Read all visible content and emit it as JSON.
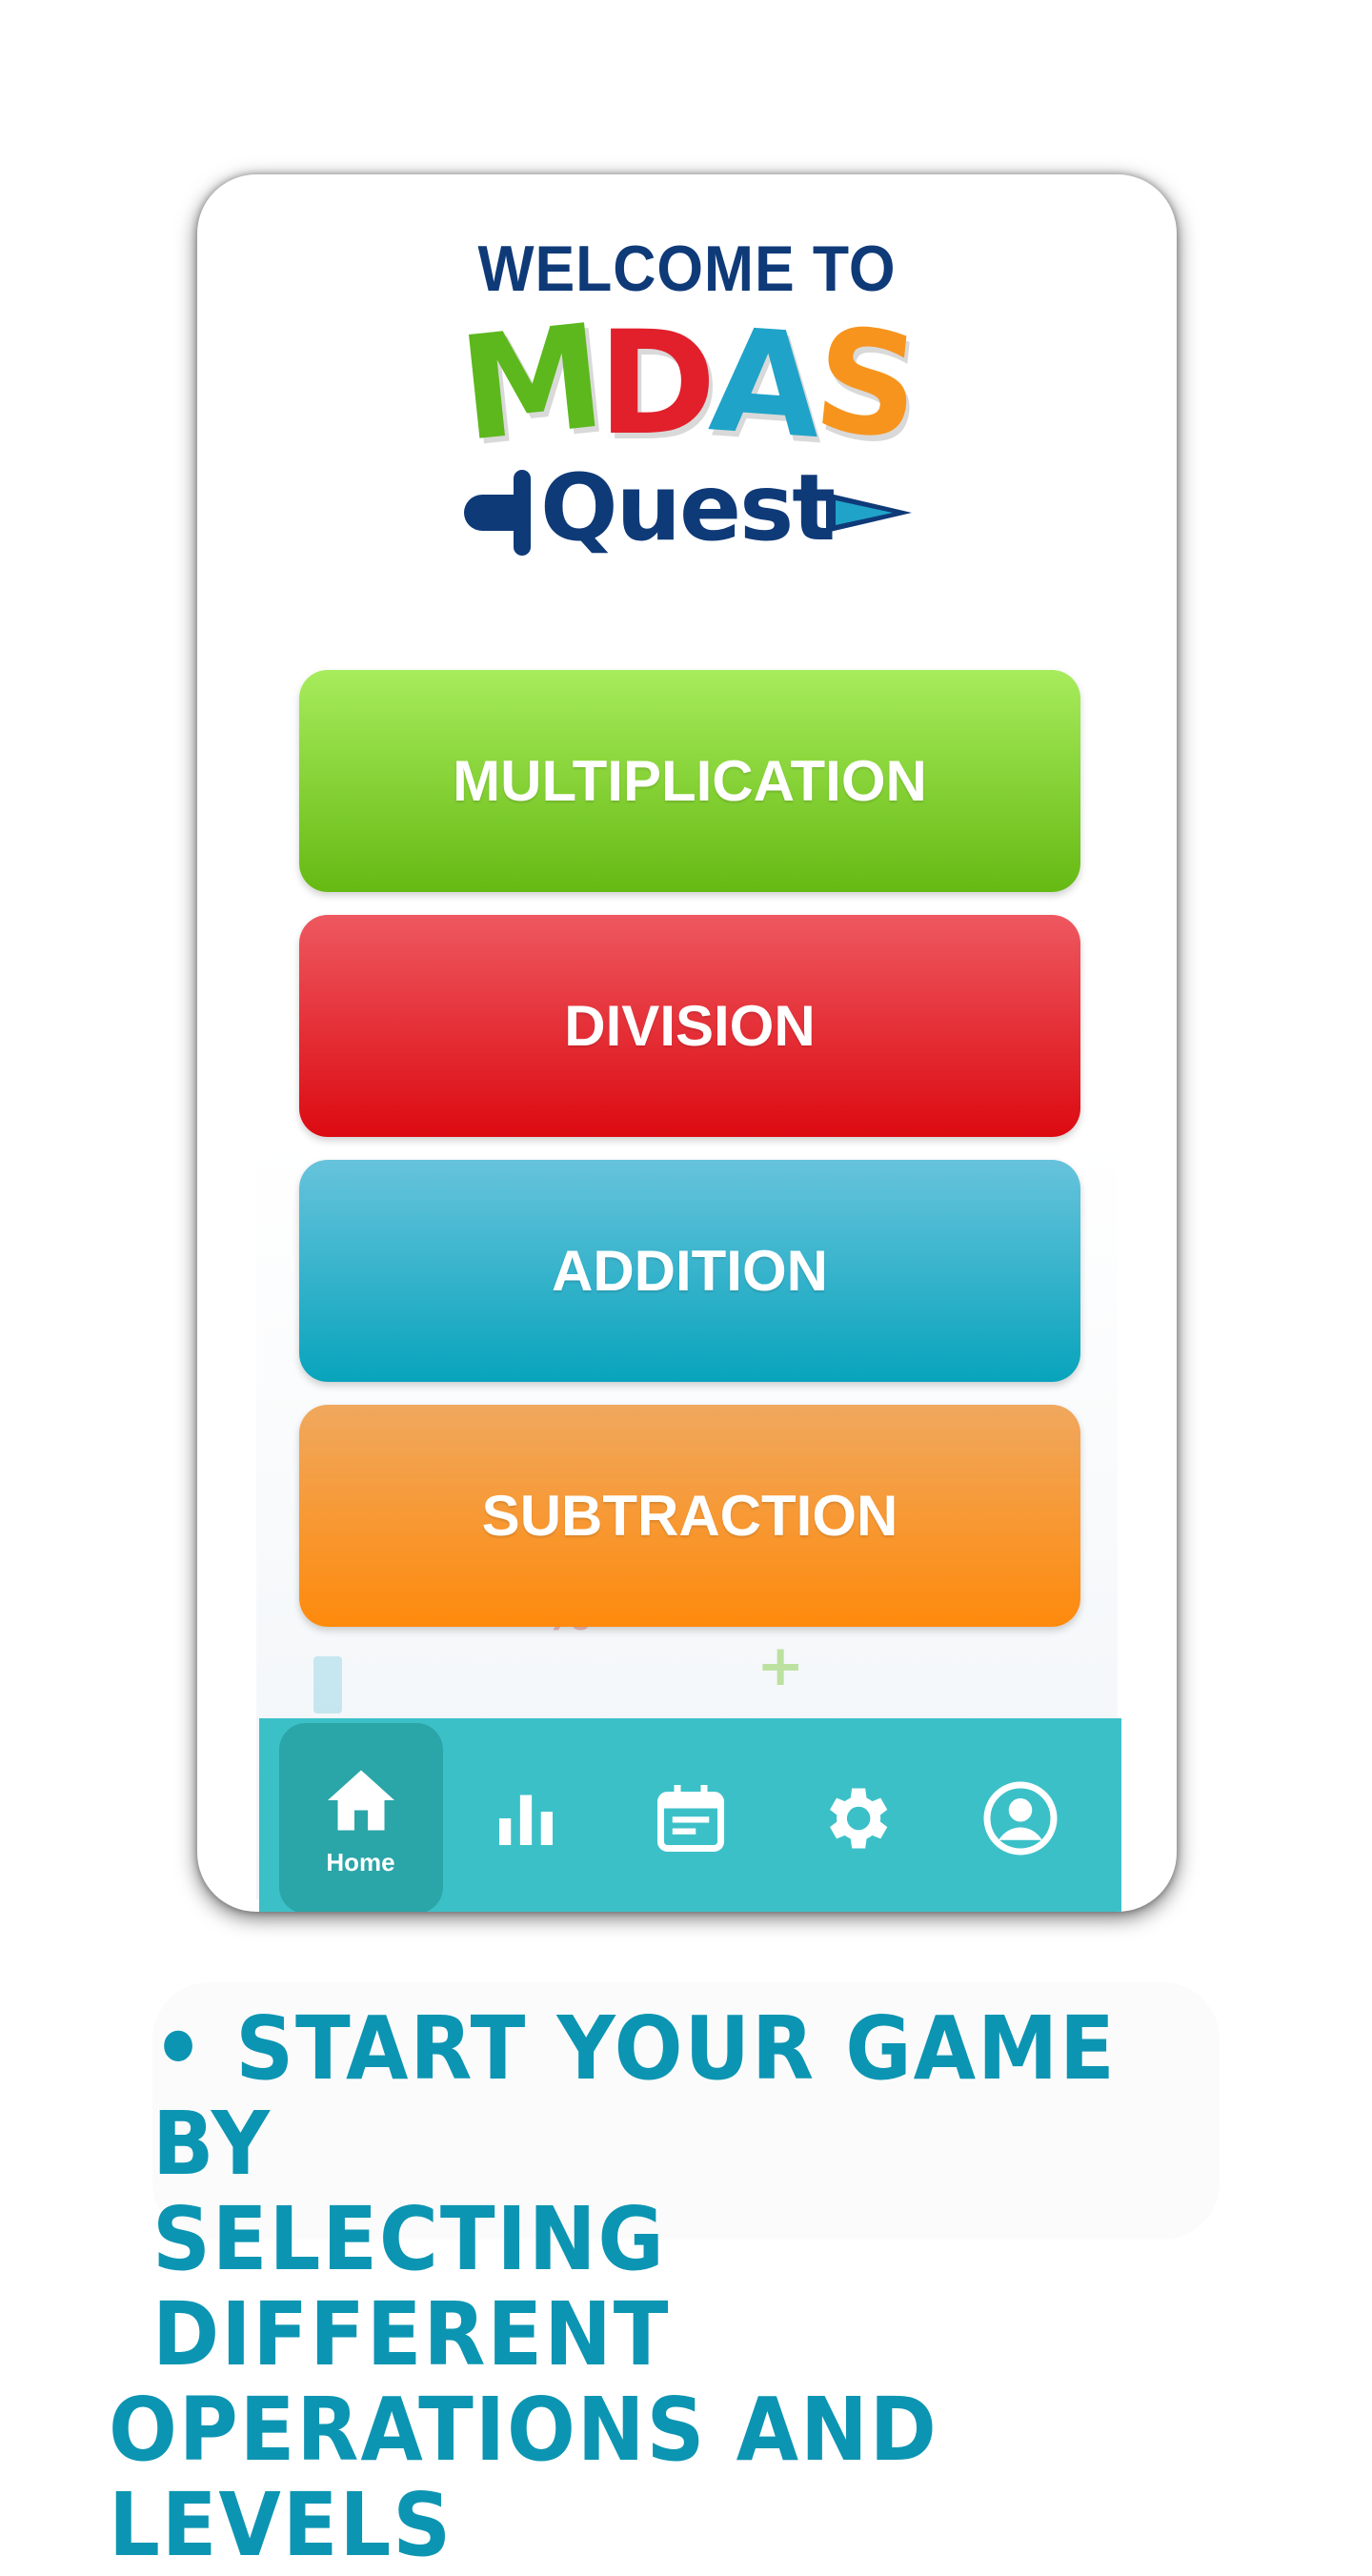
{
  "welcome_text": "WELCOME TO",
  "logo": {
    "letters": [
      "M",
      "D",
      "A",
      "S"
    ],
    "subtitle": "Quest"
  },
  "menu": {
    "buttons": [
      {
        "label": "MULTIPLICATION",
        "color_top": "#a7ec5c",
        "color_bottom": "#66b913"
      },
      {
        "label": "DIVISION",
        "color_top": "#ee5860",
        "color_bottom": "#dc0a11"
      },
      {
        "label": "ADDITION",
        "color_top": "#67c3dc",
        "color_bottom": "#08a4bc"
      },
      {
        "label": "SUBTRACTION",
        "color_top": "#f0a85e",
        "color_bottom": "#fe8a0c"
      }
    ]
  },
  "nav": {
    "items": [
      {
        "icon": "home-icon",
        "label": "Home",
        "active": true
      },
      {
        "icon": "stats-icon",
        "label": "",
        "active": false
      },
      {
        "icon": "calendar-icon",
        "label": "",
        "active": false
      },
      {
        "icon": "gear-icon",
        "label": "",
        "active": false
      },
      {
        "icon": "profile-icon",
        "label": "",
        "active": false
      }
    ],
    "background": "#3cc0c8"
  },
  "caption": {
    "line1": "• START YOUR GAME BY",
    "line2": "SELECTING DIFFERENT",
    "line3": "OPERATIONS AND LEVELS",
    "color": "#0c95b2"
  }
}
